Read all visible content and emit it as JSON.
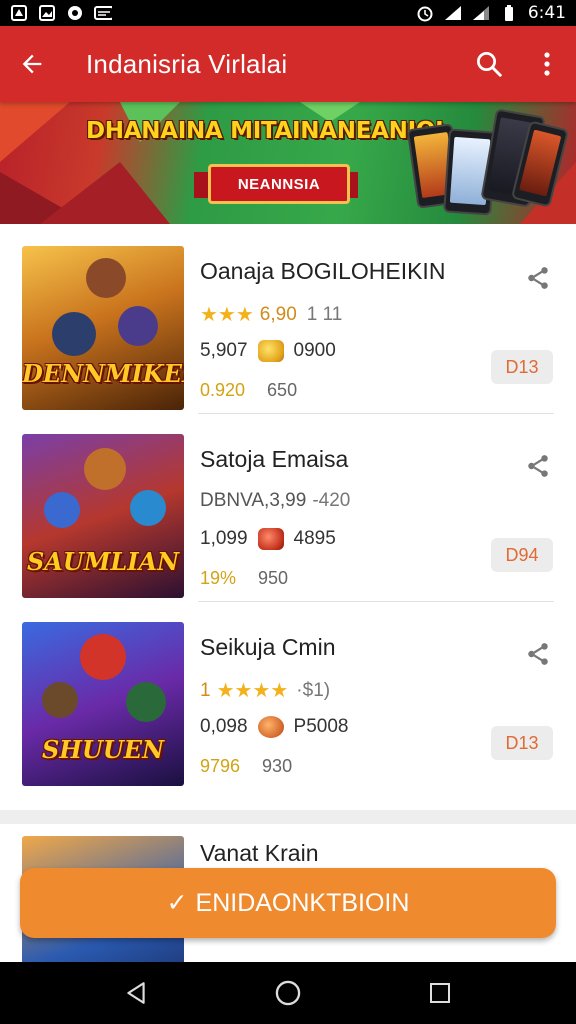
{
  "status_bar": {
    "time": "6:41",
    "icons": [
      "notification-icon",
      "image-icon",
      "circle-icon",
      "mail-icon",
      "alarm-icon",
      "signal-icon",
      "signal-icon",
      "battery-icon"
    ]
  },
  "app_bar": {
    "title": "Indanisria Virlalai",
    "icons": [
      "back-arrow-icon",
      "search-icon",
      "more-vert-icon"
    ]
  },
  "banner": {
    "headline": "DHANAINA MITAINANEANIOI",
    "ribbon": "NEANNSIA"
  },
  "apps": [
    {
      "name": "Oanaja BOGILOHEIKIN",
      "stars": "★★★",
      "rating": "6,90",
      "rating_extra": "1 11",
      "downloads": "5,907",
      "coins": "0900",
      "meta_a": "0.920",
      "meta_b": "650",
      "price": "D13",
      "thumb_title": "DENNMIKEN"
    },
    {
      "name": "Satoja Emaisa",
      "rating_text": "DBNVA,3,99",
      "rating_extra": "-420",
      "downloads": "1,099",
      "coins": "4895",
      "meta_a": "19%",
      "meta_b": "950",
      "price": "D94",
      "thumb_title": "SAUMLIAN"
    },
    {
      "name": "Seikuja Cmin",
      "rating_prefix": "1",
      "stars": "★★★★",
      "rating_extra": "·$1)",
      "downloads": "0,098",
      "coins": "P5008",
      "meta_a": "9796",
      "meta_b": "930",
      "price": "D13",
      "thumb_title": "SHUUEN"
    },
    {
      "name": "Vanat Krain"
    }
  ],
  "cta": {
    "check": "✓",
    "label": "ENIDAONKTBIOIN"
  },
  "nav_bar": {
    "icons": [
      "back-triangle-icon",
      "home-circle-icon",
      "recents-square-icon"
    ]
  },
  "colors": {
    "app_bar": "#d32a2a",
    "cta": "#ef8a2e",
    "price_text": "#e26a33",
    "star": "#f3b21b"
  }
}
